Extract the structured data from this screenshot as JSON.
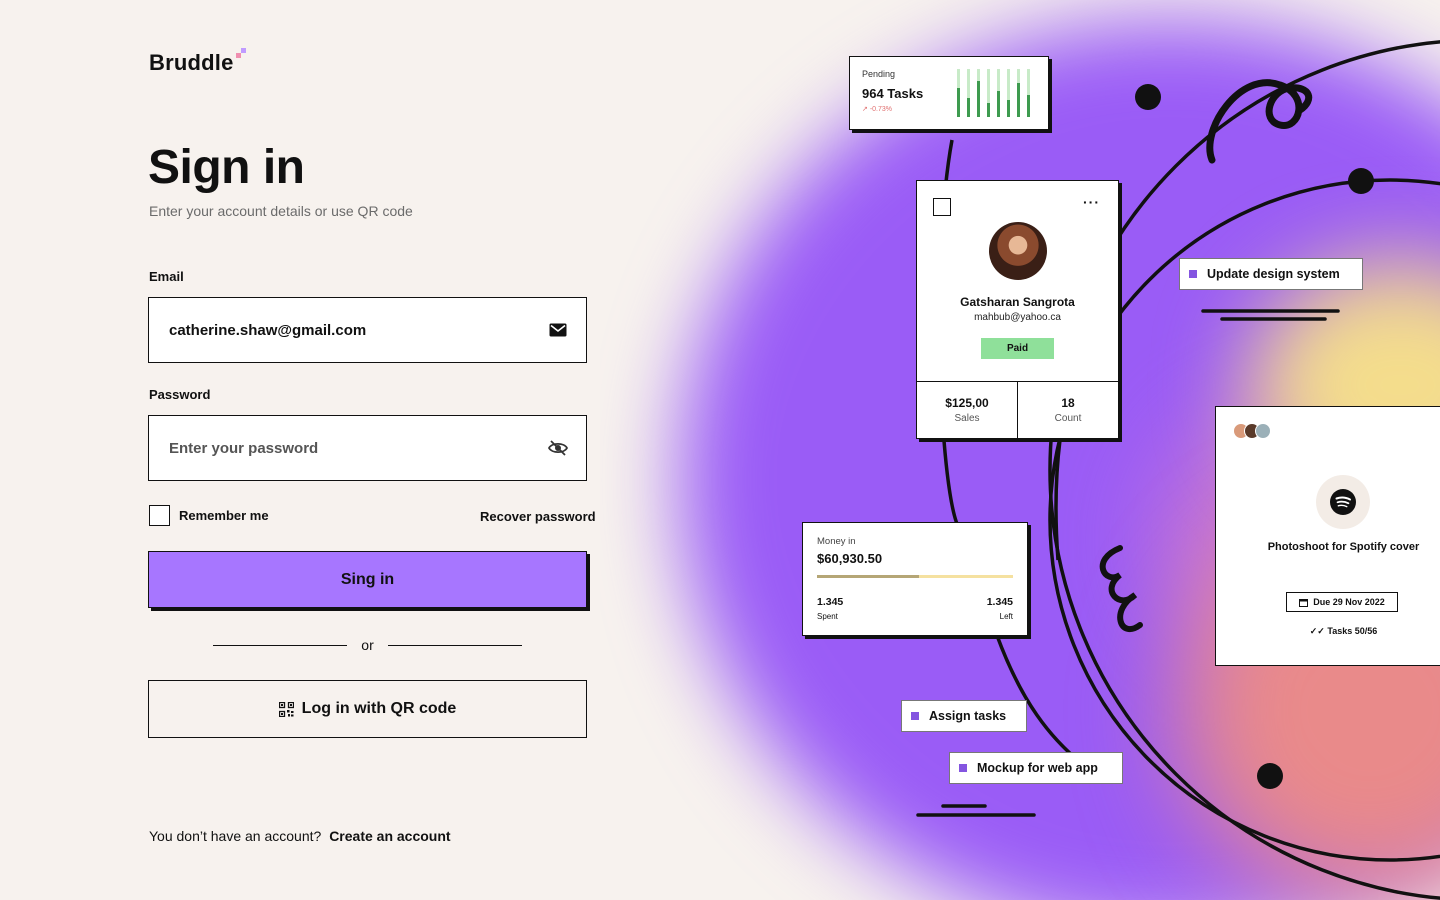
{
  "brand": {
    "name": "Bruddle"
  },
  "form": {
    "title": "Sign in",
    "subtitle": "Enter your account details or use QR code",
    "email": {
      "label": "Email",
      "value": "catherine.shaw@gmail.com",
      "icon": "mail-icon"
    },
    "password": {
      "label": "Password",
      "placeholder": "Enter your password",
      "icon": "eye-off-icon"
    },
    "remember_label": "Remember me",
    "recover_label": "Recover password",
    "submit_label": "Sing in",
    "or_label": "or",
    "qr_label": "Log in with QR code",
    "signup_prompt": "You don’t have an account?",
    "signup_link": "Create an account"
  },
  "illustration": {
    "pending": {
      "label": "Pending",
      "value": "964 Tasks",
      "delta": "-0.73%",
      "bar_fill": [
        0.6,
        0.4,
        0.75,
        0.3,
        0.55,
        0.35,
        0.7,
        0.45
      ]
    },
    "profile": {
      "name": "Gatsharan Sangrota",
      "email": "mahbub@yahoo.ca",
      "status": "Paid",
      "sales_value": "$125,00",
      "sales_label": "Sales",
      "count_value": "18",
      "count_label": "Count"
    },
    "money": {
      "label": "Money in",
      "value": "$60,930.50",
      "progress": 0.52,
      "spent_value": "1.345",
      "spent_label": "Spent",
      "left_value": "1.345",
      "left_label": "Left"
    },
    "task_card": {
      "title": "Photoshoot for Spotify cover",
      "due": "Due 29 Nov 2022",
      "tasks": "Tasks 50/56"
    },
    "tags": {
      "design": "Update design system",
      "assign": "Assign tasks",
      "mockup": "Mockup for web app"
    },
    "colors": {
      "accent": "#a776ff",
      "paid": "#8fe09a",
      "tag_square": "#8455e0"
    }
  }
}
